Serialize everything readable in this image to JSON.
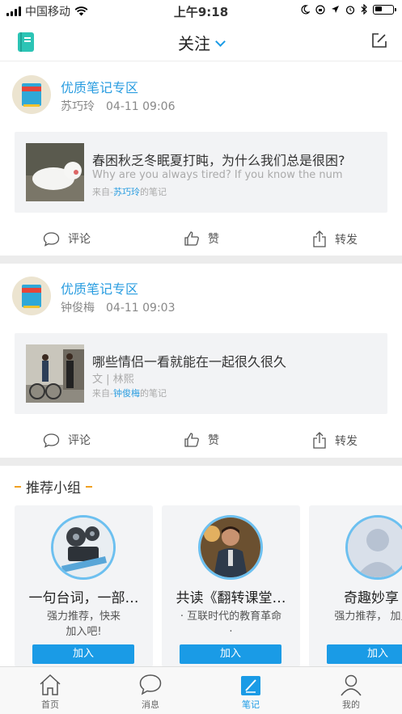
{
  "status_bar": {
    "carrier": "中国移动",
    "time": "上午9:18"
  },
  "nav": {
    "title": "关注",
    "left_icon": "notebook-icon",
    "right_icon": "edit-icon"
  },
  "posts": [
    {
      "title": "优质笔记专区",
      "author": "苏巧玲",
      "time": "04-11 09:06",
      "note_title": "春困秋乏冬眠夏打盹，为什么我们总是很困?",
      "note_sub": "Why are you always tired? If you know the num",
      "from_prefix": "来自-",
      "from_author": "苏巧玲",
      "from_suffix": "的笔记",
      "actions": {
        "comment": "评论",
        "like": "赞",
        "share": "转发"
      }
    },
    {
      "title": "优质笔记专区",
      "author": "钟俊梅",
      "time": "04-11 09:03",
      "note_title": "哪些情侣一看就能在一起很久很久",
      "note_sub": "文 | 林熙",
      "from_prefix": "来自-",
      "from_author": "钟俊梅",
      "from_suffix": "的笔记",
      "actions": {
        "comment": "评论",
        "like": "赞",
        "share": "转发"
      }
    }
  ],
  "recommend": {
    "header": "推荐小组",
    "groups": [
      {
        "name": "一句台词，一部…",
        "desc": "强力推荐，快来\n加入吧!",
        "join": "加入"
      },
      {
        "name": "共读《翻转课堂…",
        "desc": "· 互联时代的教育革命\n·",
        "join": "加入"
      },
      {
        "name": "奇趣妙享（",
        "desc": "强力推荐，\n加入吧",
        "join": "加入"
      }
    ]
  },
  "tabbar": {
    "items": [
      {
        "label": "首页",
        "icon": "home-icon"
      },
      {
        "label": "消息",
        "icon": "chat-icon"
      },
      {
        "label": "笔记",
        "icon": "note-icon",
        "active": true
      },
      {
        "label": "我的",
        "icon": "user-icon"
      }
    ]
  },
  "colors": {
    "accent": "#1a9be6",
    "link": "#2a9de0",
    "gold": "#f0a020"
  }
}
